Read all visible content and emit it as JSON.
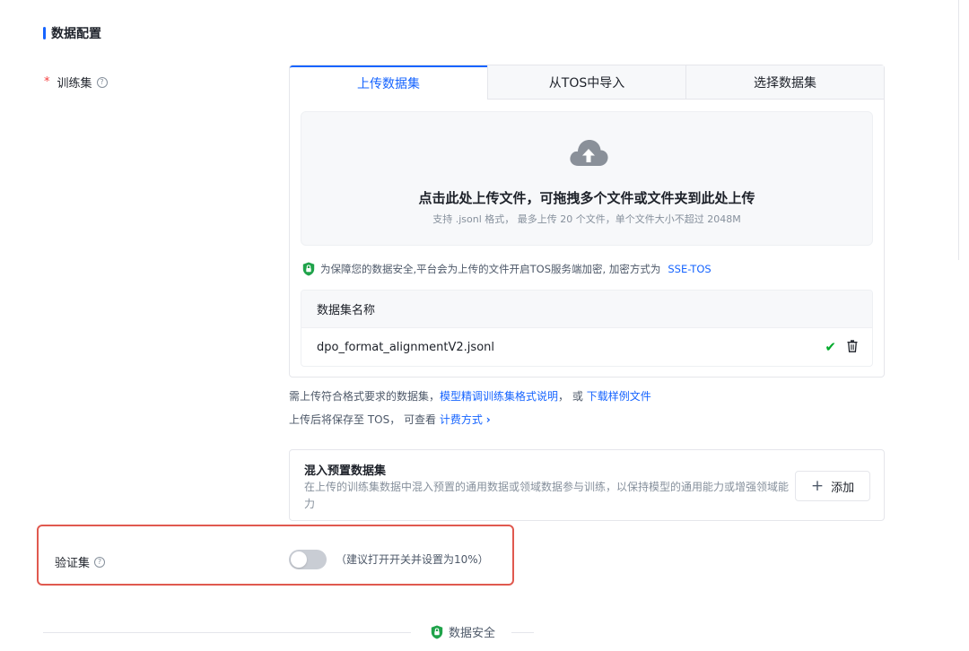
{
  "section": {
    "title": "数据配置"
  },
  "training_set": {
    "required_mark": "*",
    "label": "训练集",
    "help": "?",
    "tabs": [
      {
        "label": "上传数据集",
        "active": true
      },
      {
        "label": "从TOS中导入",
        "active": false
      },
      {
        "label": "选择数据集",
        "active": false
      }
    ],
    "dropzone": {
      "icon": "cloud-upload-icon",
      "title": "点击此处上传文件，可拖拽多个文件或文件夹到此处上传",
      "subtitle": "支持 .jsonl 格式， 最多上传 20 个文件，单个文件大小不超过 2048M"
    },
    "security_note": {
      "text": "为保障您的数据安全,平台会为上传的文件开启TOS服务端加密, 加密方式为",
      "method": "SSE-TOS"
    },
    "table": {
      "header": "数据集名称",
      "rows": [
        {
          "name": "dpo_format_alignmentV2.jsonl",
          "status": "uploaded"
        }
      ]
    },
    "hint1": {
      "prefix": "需上传符合格式要求的数据集，",
      "link1": "模型精调训练集格式说明",
      "middle": "， 或",
      "link2": "下载样例文件"
    },
    "hint2": {
      "prefix": "上传后将保存至 TOS， 可查看",
      "link": "计费方式",
      "chevron": "›"
    }
  },
  "mix_preset": {
    "title": "混入预置数据集",
    "description": "在上传的训练集数据中混入预置的通用数据或领域数据参与训练，以保持模型的通用能力或增强领域能力",
    "add_button": {
      "icon": "+",
      "label": "添加"
    }
  },
  "validation_set": {
    "label": "验证集",
    "help": "?",
    "toggle_on": false,
    "hint": "（建议打开开关并设置为10%）"
  },
  "bottom_section": {
    "title": "数据安全"
  },
  "colors": {
    "primary": "#1664ff",
    "success": "#00aa2a",
    "highlight": "#e0594f",
    "required": "#f53f3f"
  }
}
